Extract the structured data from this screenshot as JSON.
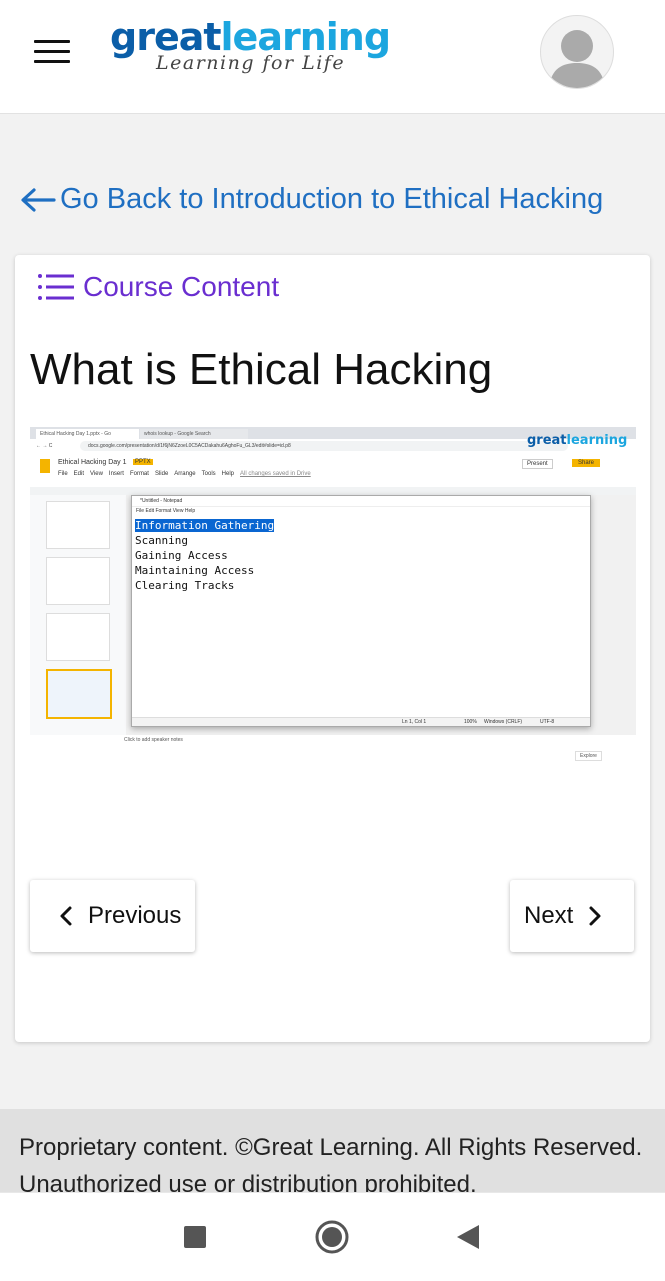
{
  "header": {
    "menu_icon": "hamburger-menu-icon",
    "logo": {
      "word_great": "great",
      "word_learning": "learning",
      "tagline": "Learning for Life"
    },
    "avatar_icon": "user-avatar-icon"
  },
  "back_link": {
    "label": "Go Back to Introduction to Ethical Hacking",
    "icon": "arrow-left-icon"
  },
  "course_content": {
    "label": "Course Content",
    "icon": "list-icon"
  },
  "lesson": {
    "title": "What is Ethical Hacking"
  },
  "screenshot": {
    "browser_tabs": [
      "Ethical Hacking Day 1.pptx - Go",
      "whois lookup - Google Search"
    ],
    "url": "docs.google.com/presentation/d/1f6jN6ZzoeL0C5ACDakahu6AghoFu_GL3/edit#slide=id.p8",
    "doc_title": "Ethical Hacking Day 1",
    "doc_badge": "PPTX",
    "doc_menu": [
      "File",
      "Edit",
      "View",
      "Insert",
      "Format",
      "Slide",
      "Arrange",
      "Tools",
      "Help"
    ],
    "doc_saved": "All changes saved in Drive",
    "present_label": "Present",
    "share_label": "Share",
    "notepad_title": "*Untitled - Notepad",
    "notepad_menu": [
      "File",
      "Edit",
      "Format",
      "View",
      "Help"
    ],
    "notepad_lines": [
      "Information Gathering",
      "Scanning",
      "Gaining Access",
      "Maintaining Access",
      "Clearing Tracks"
    ],
    "notepad_status": [
      "Ln 1, Col 1",
      "100%",
      "Windows (CRLF)",
      "UTF-8"
    ],
    "speaker_notes": "Click to add speaker notes",
    "explore_label": "Explore",
    "watermark_great": "great",
    "watermark_learning": "learning"
  },
  "nav_buttons": {
    "previous": "Previous",
    "next": "Next"
  },
  "footer": {
    "text": "Proprietary content. ©Great Learning. All Rights Reserved. Unauthorized use or distribution prohibited."
  },
  "system_nav": {
    "recents_icon": "recents-square-icon",
    "home_icon": "home-circle-icon",
    "back_icon": "back-triangle-icon"
  },
  "colors": {
    "brand_dark": "#0b5ea8",
    "brand_light": "#1ca6df",
    "link": "#1f6fc2",
    "course": "#6a2ed0"
  }
}
